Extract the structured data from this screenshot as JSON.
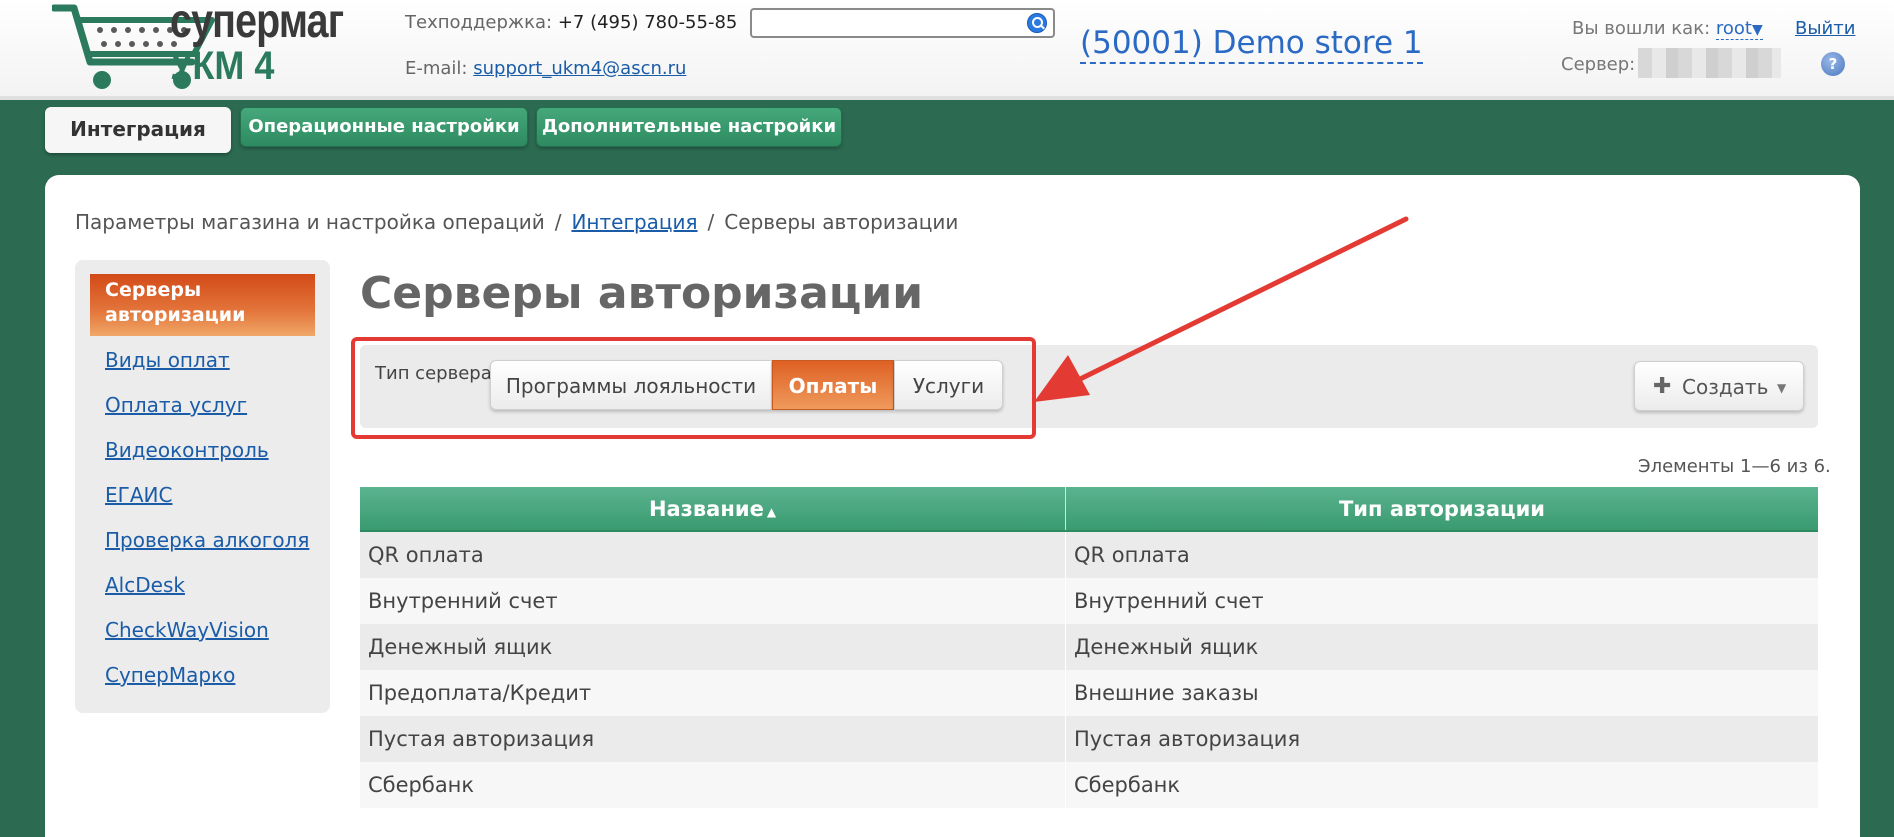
{
  "header": {
    "logo": {
      "line1": "супермаг",
      "line2": "УКМ 4"
    },
    "support_label": "Техподдержка:",
    "support_phone": "+7 (495) 780-55-85",
    "email_label": "E-mail:",
    "email": "support_ukm4@ascn.ru",
    "search": {
      "value": "",
      "placeholder": ""
    },
    "store": "(50001) Demo store 1",
    "user_label": "Вы вошли как:",
    "user_name": "root",
    "user_caret": "▼",
    "logout": "Выйти",
    "server_label": "Сервер:",
    "help": "?"
  },
  "tabs": [
    {
      "label": "Интеграция",
      "active": true
    },
    {
      "label": "Операционные настройки",
      "active": false
    },
    {
      "label": "Дополнительные настройки",
      "active": false
    }
  ],
  "breadcrumb": {
    "part1": "Параметры магазина и настройка операций",
    "sep": "/",
    "part2": "Интеграция",
    "part3": "Серверы авторизации"
  },
  "sidebar": {
    "active": "Серверы авторизации",
    "items": [
      "Виды оплат",
      "Оплата услуг",
      "Видеоконтроль",
      "ЕГАИС",
      "Проверка алкоголя",
      "AlcDesk",
      "CheckWayVision",
      "СуперМарко"
    ]
  },
  "main": {
    "title": "Серверы авторизации",
    "filter_label": "Тип сервера:",
    "segments": [
      "Программы лояльности",
      "Оплаты",
      "Услуги"
    ],
    "selected_segment": "Оплаты",
    "create_plus": "✚",
    "create_label": "Создать",
    "create_caret": "▼",
    "counter": "Элементы 1—6 из 6."
  },
  "table": {
    "columns": [
      "Название",
      "Тип авторизации"
    ],
    "sort_indicator": "▲",
    "rows": [
      [
        "QR оплата",
        "QR оплата"
      ],
      [
        "Внутренний счет",
        "Внутренний счет"
      ],
      [
        "Денежный ящик",
        "Денежный ящик"
      ],
      [
        "Предоплата/Кредит",
        "Внешние заказы"
      ],
      [
        "Пустая авторизация",
        "Пустая авторизация"
      ],
      [
        "Сбербанк",
        "Сбербанк"
      ]
    ]
  },
  "colors": {
    "brand_green": "#2c6b52",
    "accent_orange": "#e3753b",
    "link_blue": "#1a5ca8",
    "annotation_red": "#e33b34"
  }
}
